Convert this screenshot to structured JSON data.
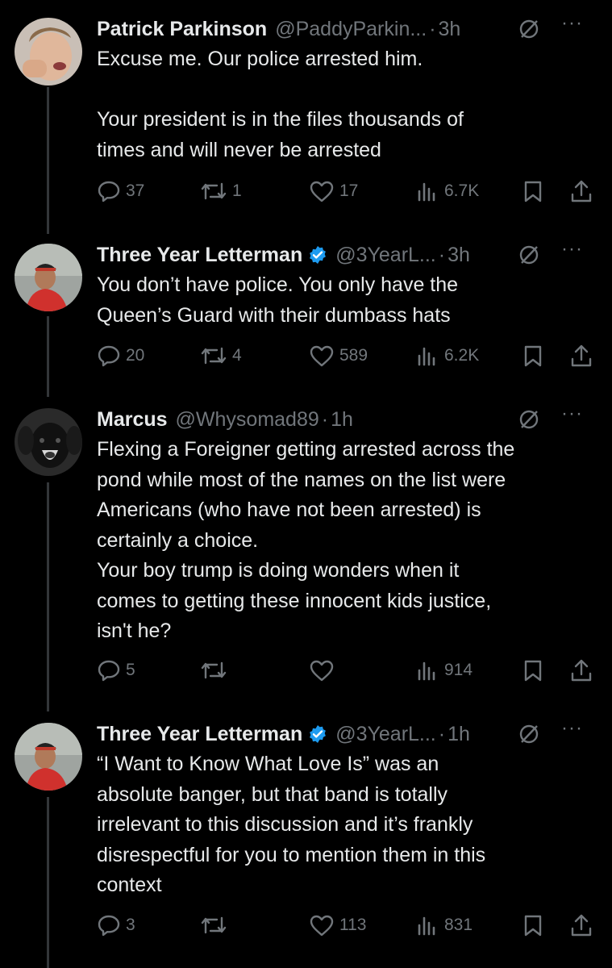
{
  "tweets": [
    {
      "name": "Patrick Parkinson",
      "verified": false,
      "handle": "@PaddyParkin...",
      "time": "3h",
      "text": [
        "Excuse me. Our police arrested him.",
        "",
        "Your president is in the files thousands of",
        "times and will never be arrested"
      ],
      "replies": "37",
      "retweets": "1",
      "likes": "17",
      "views": "6.7K"
    },
    {
      "name": "Three Year Letterman",
      "verified": true,
      "handle": "@3YearL...",
      "time": "3h",
      "text": [
        "You don’t have police. You only have the",
        "Queen’s Guard with their dumbass hats"
      ],
      "replies": "20",
      "retweets": "4",
      "likes": "589",
      "views": "6.2K"
    },
    {
      "name": "Marcus",
      "verified": false,
      "handle": "@Whysomad89",
      "time": "1h",
      "text": [
        "Flexing a Foreigner getting arrested across the",
        "pond while most of the names on the list were",
        "Americans (who have not been arrested) is",
        "certainly a choice.",
        "Your boy trump is doing wonders when it",
        "comes to getting these innocent kids justice,",
        "isn't he?"
      ],
      "replies": "5",
      "retweets": "",
      "likes": "",
      "views": "914"
    },
    {
      "name": "Three Year Letterman",
      "verified": true,
      "handle": "@3YearL...",
      "time": "1h",
      "text": [
        "“I Want to Know What Love Is” was an",
        "absolute banger, but that band is totally",
        "irrelevant to this discussion and it’s frankly",
        "disrespectful for you to mention them in this",
        "context"
      ],
      "replies": "3",
      "retweets": "",
      "likes": "113",
      "views": "831"
    }
  ],
  "ui": {
    "dot": "·",
    "more": "···"
  },
  "colors": {
    "background": "#000000",
    "text": "#e7e9ea",
    "muted": "#71767b",
    "verified": "#1d9bf0",
    "thread": "#333639"
  },
  "icons": [
    "reply-icon",
    "retweet-icon",
    "like-icon",
    "views-icon",
    "bookmark-icon",
    "share-icon",
    "grok-icon",
    "more-icon",
    "verified-badge-icon"
  ]
}
